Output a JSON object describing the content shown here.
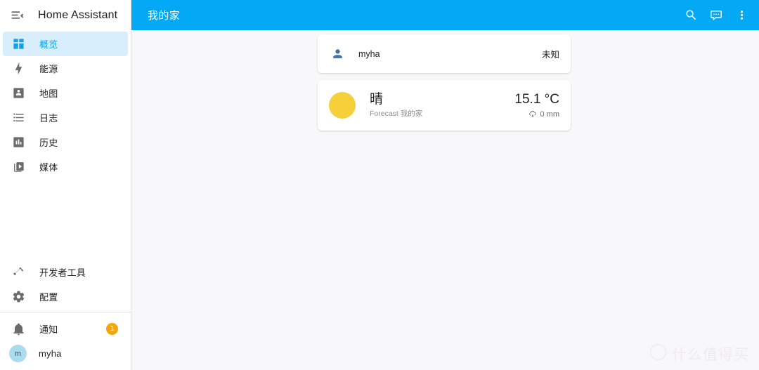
{
  "sidebar": {
    "title": "Home Assistant",
    "menu_icon": "menu-open-icon",
    "items": [
      {
        "label": "概览",
        "icon": "view-dashboard-icon",
        "selected": true
      },
      {
        "label": "能源",
        "icon": "lightning-bolt-icon",
        "selected": false
      },
      {
        "label": "地图",
        "icon": "map-marker-account-icon",
        "selected": false
      },
      {
        "label": "日志",
        "icon": "format-list-bulleted-icon",
        "selected": false
      },
      {
        "label": "历史",
        "icon": "chart-box-icon",
        "selected": false
      },
      {
        "label": "媒体",
        "icon": "play-box-multiple-icon",
        "selected": false
      }
    ],
    "tools": [
      {
        "label": "开发者工具",
        "icon": "hammer-icon"
      },
      {
        "label": "配置",
        "icon": "cog-icon"
      }
    ],
    "notifications": {
      "label": "通知",
      "icon": "bell-icon",
      "badge": "1",
      "badge_color": "#f6a609"
    },
    "user": {
      "label": "myha",
      "avatar_initial": "m",
      "avatar_color": "#aadcf0"
    },
    "selected_bg": "#d9eefc",
    "selected_color": "#12a2e8"
  },
  "toolbar": {
    "title": "我的家",
    "bg_color": "#03a9f4",
    "actions": [
      {
        "name": "search-icon",
        "label": "搜索"
      },
      {
        "name": "assist-icon",
        "label": "Assist"
      },
      {
        "name": "overflow-menu-icon",
        "label": "菜单"
      }
    ]
  },
  "view": {
    "background": "#f8f7fa",
    "cards": [
      {
        "type": "entities",
        "rows": [
          {
            "icon": "account-icon",
            "name": "myha",
            "state": "未知"
          }
        ]
      },
      {
        "type": "weather",
        "icon": "sunny-icon",
        "icon_color": "#f5d03a",
        "condition": "晴",
        "subtitle": "Forecast 我的家",
        "temperature": "15.1 °C",
        "precipitation": "0 mm",
        "precipitation_icon": "weather-rainy-icon"
      }
    ]
  },
  "watermark": {
    "mark": "值",
    "text": "什么值得买"
  }
}
